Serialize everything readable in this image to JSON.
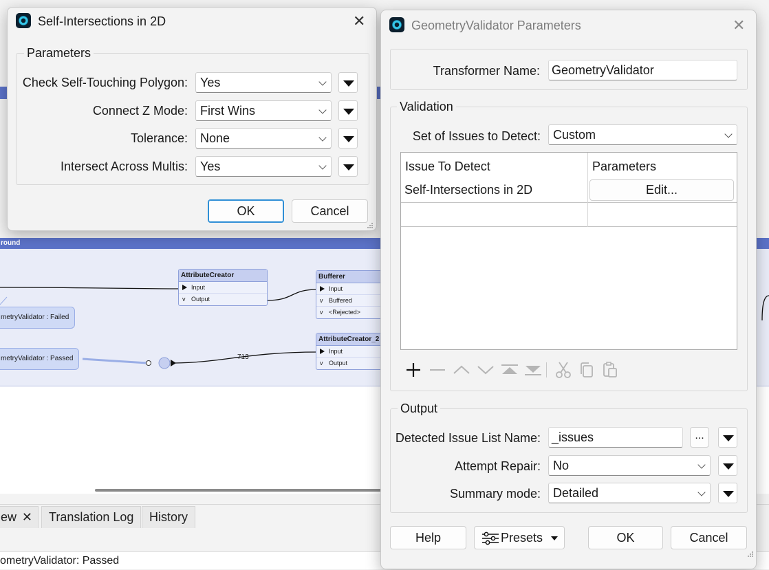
{
  "colors": {
    "accent": "#2f8fd6",
    "bookmark": "#5c73c9",
    "node_fill": "#eef1fb",
    "bubble": "#cfdaf6"
  },
  "canvas": {
    "bookmark_title": "round",
    "nodes": [
      {
        "title": "AttributeCreator",
        "ports": [
          "Input",
          "Output"
        ]
      },
      {
        "title": "Bufferer",
        "ports": [
          "Input",
          "Buffered",
          "<Rejected>"
        ]
      },
      {
        "title": "AttributeCreator_2",
        "ports": [
          "Input",
          "Output"
        ]
      }
    ],
    "bubbles": [
      "metryValidator : Failed",
      "metryValidator : Passed"
    ],
    "wire_count": "713"
  },
  "bottom": {
    "tabs": [
      "ew",
      "Translation Log",
      "History"
    ],
    "log_line": "ometryValidator: Passed"
  },
  "self_dialog": {
    "title": "Self-Intersections in 2D",
    "group": "Parameters",
    "rows": [
      {
        "label": "Check Self-Touching Polygon:",
        "value": "Yes"
      },
      {
        "label": "Connect Z Mode:",
        "value": "First Wins"
      },
      {
        "label": "Tolerance:",
        "value": "None"
      },
      {
        "label": "Intersect Across Multis:",
        "value": "Yes"
      }
    ],
    "ok": "OK",
    "cancel": "Cancel"
  },
  "gv_dialog": {
    "title": "GeometryValidator Parameters",
    "transformer_label": "Transformer Name:",
    "transformer_value": "GeometryValidator",
    "validation": {
      "group": "Validation",
      "issues_label": "Set of Issues to Detect:",
      "issues_value": "Custom",
      "table": {
        "headers": [
          "Issue To Detect",
          "Parameters"
        ],
        "row_issue": "Self-Intersections in 2D",
        "row_button": "Edit..."
      },
      "toolbar_icons": [
        "add-icon",
        "remove-icon",
        "move-up-icon",
        "move-down-icon",
        "move-top-icon",
        "move-bottom-icon",
        "cut-icon",
        "copy-icon",
        "paste-icon"
      ]
    },
    "output": {
      "group": "Output",
      "list_label": "Detected Issue List Name:",
      "list_value": "_issues",
      "ellipsis": "...",
      "repair_label": "Attempt Repair:",
      "repair_value": "No",
      "summary_label": "Summary mode:",
      "summary_value": "Detailed"
    },
    "buttons": {
      "help": "Help",
      "presets": "Presets",
      "ok": "OK",
      "cancel": "Cancel"
    }
  }
}
